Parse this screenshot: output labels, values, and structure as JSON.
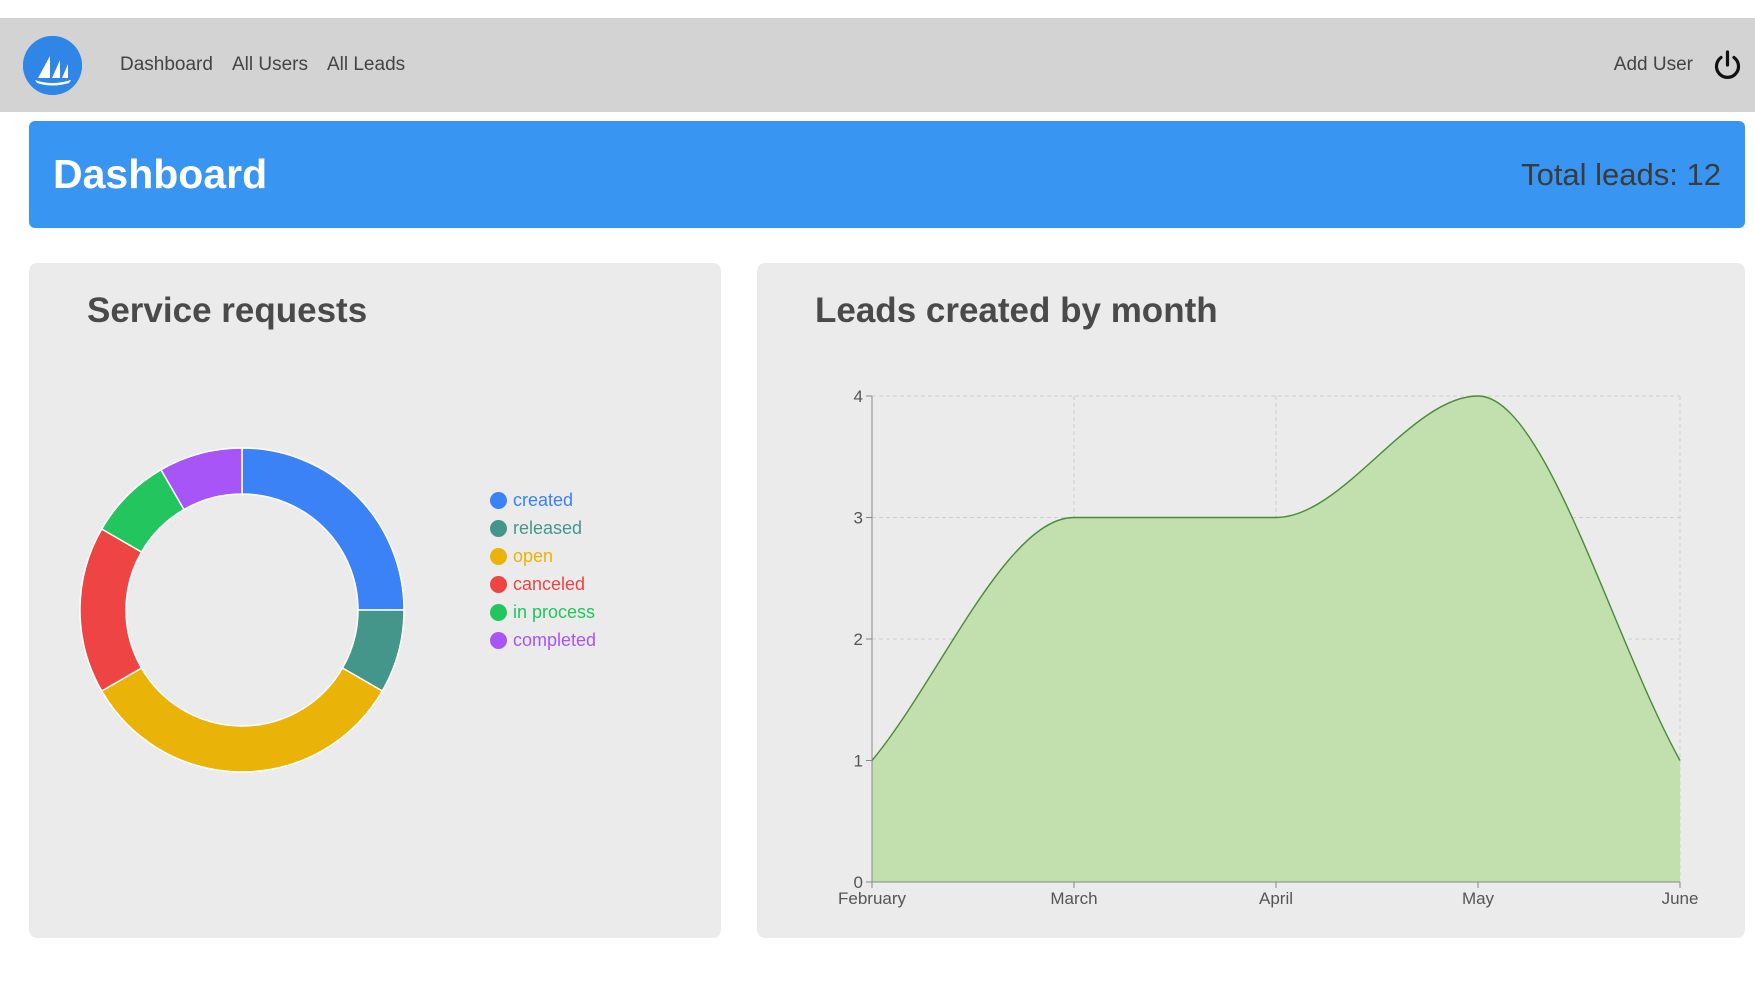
{
  "nav": {
    "logo": "sailboat-logo",
    "links": [
      "Dashboard",
      "All Users",
      "All Leads"
    ],
    "add_user": "Add User",
    "power_icon": "power-icon"
  },
  "header": {
    "title": "Dashboard",
    "total_leads": "Total leads: 12",
    "color": "#3895f2"
  },
  "service_card": {
    "title": "Service requests",
    "legend": [
      {
        "label": "created",
        "color": "#3b82f6"
      },
      {
        "label": "released",
        "color": "#45968a"
      },
      {
        "label": "open",
        "color": "#eab308"
      },
      {
        "label": "canceled",
        "color": "#ef4444"
      },
      {
        "label": "in process",
        "color": "#22c55e"
      },
      {
        "label": "completed",
        "color": "#a855f7"
      }
    ]
  },
  "leads_card": {
    "title": "Leads created by month"
  },
  "chart_data": [
    {
      "type": "pie",
      "title": "Service requests",
      "categories": [
        "created",
        "released",
        "open",
        "canceled",
        "in process",
        "completed"
      ],
      "values": [
        3,
        1,
        4,
        2,
        1,
        1
      ],
      "colors": [
        "#3b82f6",
        "#45968a",
        "#eab308",
        "#ef4444",
        "#22c55e",
        "#a855f7"
      ],
      "legend": "right"
    },
    {
      "type": "area",
      "title": "Leads created by month",
      "categories": [
        "February",
        "March",
        "April",
        "May",
        "June"
      ],
      "values": [
        1,
        3,
        3,
        4,
        1
      ],
      "ylim": [
        0,
        4
      ],
      "yticks": [
        0,
        1,
        2,
        3,
        4
      ],
      "grid": true,
      "fill_color": "#c1e0ad",
      "line_color": "#4a8a3a"
    }
  ]
}
